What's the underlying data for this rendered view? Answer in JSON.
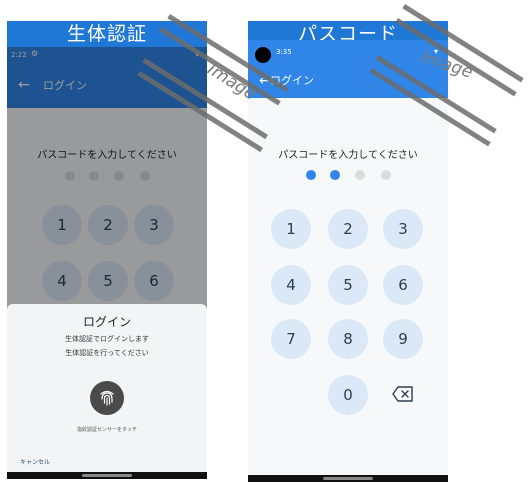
{
  "left": {
    "header": "生体認証",
    "status_time": "2:22",
    "appbar_title": "ログイン",
    "prompt": "パスコードを入力してください",
    "keys": [
      "1",
      "2",
      "3",
      "4",
      "5",
      "6"
    ],
    "dialog": {
      "title": "ログイン",
      "line1": "生体認証でログインします",
      "line2": "生体認証を行ってください",
      "sensor_hint": "指紋認証センサーをタッチ",
      "cancel": "キャンセル"
    }
  },
  "right": {
    "header": "パスコード",
    "status_time": "3:35",
    "appbar_title": "ログイン",
    "prompt": "パスコードを入力してください",
    "keys": [
      "1",
      "2",
      "3",
      "4",
      "5",
      "6",
      "7",
      "8",
      "9",
      "0"
    ],
    "entered_digits": 2,
    "total_digits": 4
  },
  "watermark": "Image",
  "colors": {
    "header_bg": "#1f78d6",
    "appbar_bg": "#2f86e8",
    "key_bg": "#dbe8f7",
    "dot_active": "#2f86e8",
    "dot_inactive": "#dcdcdc"
  },
  "icons": {
    "back": "arrow-left-icon",
    "fingerprint": "fingerprint-icon",
    "backspace": "backspace-icon",
    "wifi": "wifi-icon",
    "battery": "battery-icon"
  }
}
